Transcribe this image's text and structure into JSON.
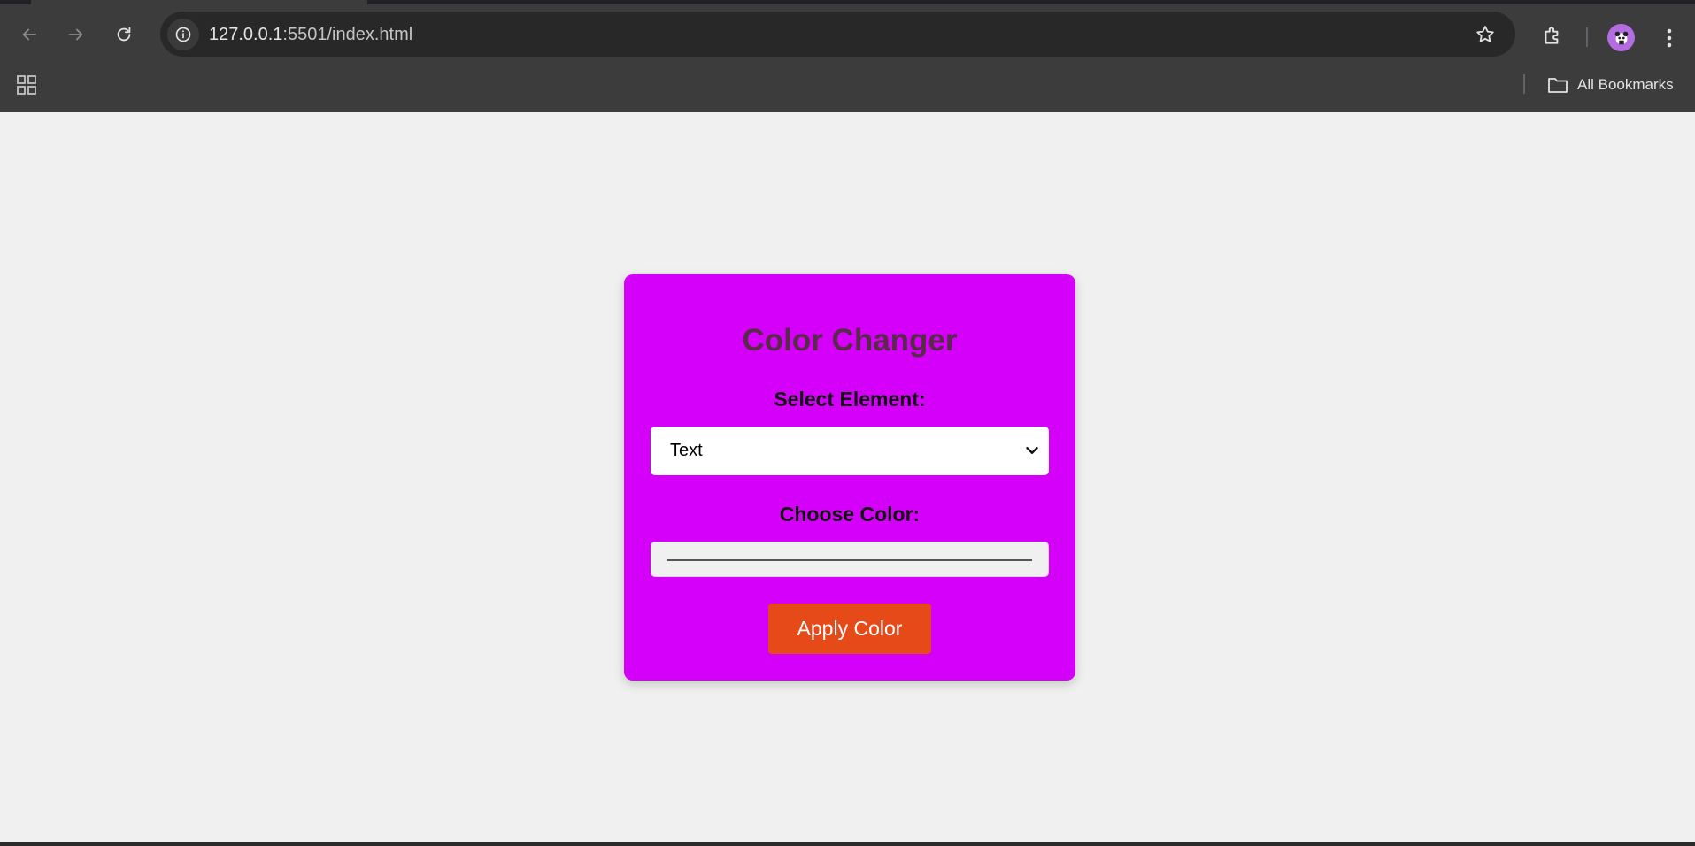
{
  "browser": {
    "url_host": "127.0.0.1",
    "url_rest": ":5501/index.html",
    "bookmarks_label": "All Bookmarks"
  },
  "app": {
    "title": "Color Changer",
    "select_label": "Select Element:",
    "select_value": "Text",
    "color_label": "Choose Color:",
    "apply_label": "Apply Color"
  },
  "colors": {
    "card": "#d500f9",
    "button": "#e64a19",
    "page_bg": "#f0f0f0"
  }
}
